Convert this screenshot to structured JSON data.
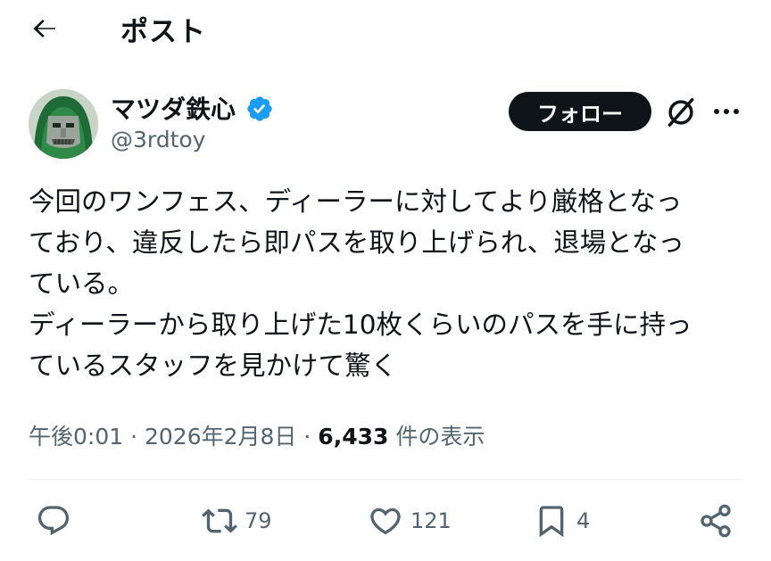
{
  "header": {
    "title": "ポスト",
    "back_icon": "arrow-left-icon"
  },
  "author": {
    "name": "マツダ鉄心",
    "handle": "@3rdtoy",
    "verified_icon": "verified-badge-icon",
    "verified_color": "#1d9bf0"
  },
  "follow_button": {
    "label": "フォロー"
  },
  "post": {
    "lines": [
      "今回のワンフェス、ディーラーに対してより厳格となっ",
      "ており、違反したら即パスを取り上げられ、退場となっ",
      "ている。",
      "ディーラーから取り上げた10枚くらいのパスを手に持っ",
      "ているスタッフを見かけて驚く"
    ]
  },
  "meta": {
    "time": "午後0:01",
    "sep1": "·",
    "date": "2026年2月8日",
    "sep2": "·",
    "views_count": "6,433",
    "views_label": "件の表示"
  },
  "actions": {
    "reply_count": "",
    "retweet_count": "79",
    "like_count": "121",
    "bookmark_count": "4"
  },
  "colors": {
    "text": "#0f1419",
    "secondary": "#536471",
    "button_bg": "#0f1419"
  }
}
